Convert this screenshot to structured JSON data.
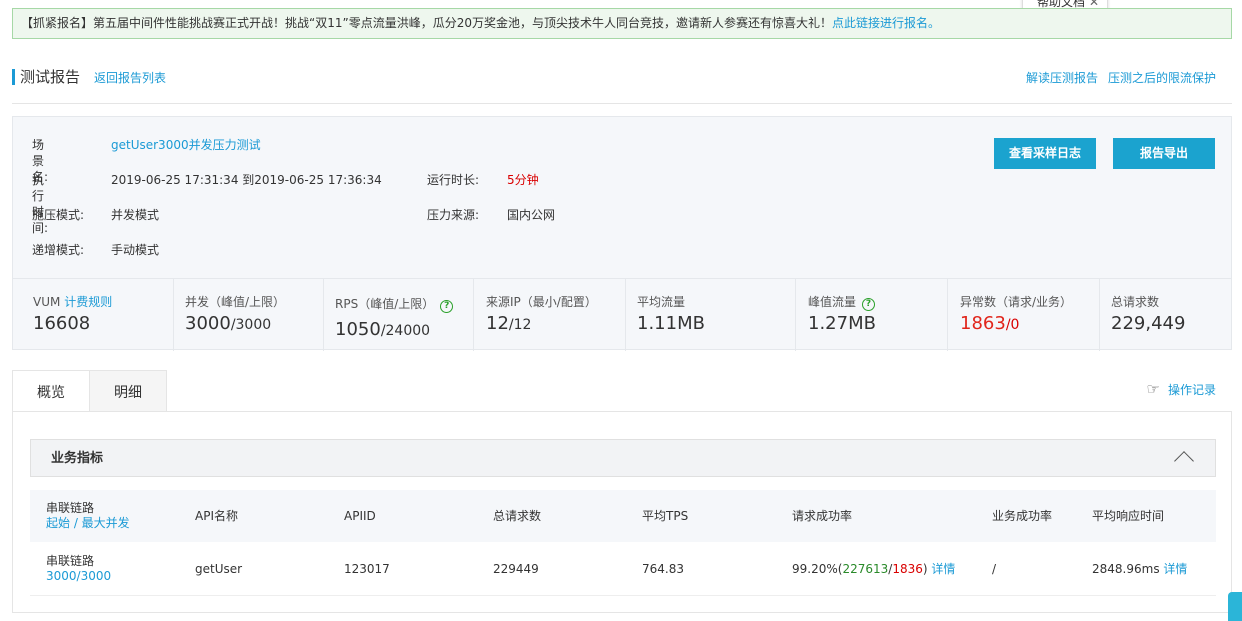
{
  "banner": {
    "text": "【抓紧报名】第五届中间件性能挑战赛正式开战！挑战“双11”零点流量洪峰，瓜分20万奖金池，与顶尖技术牛人同台竞技，邀请新人参赛还有惊喜大礼！",
    "link": "点此链接进行报名。"
  },
  "help": {
    "label": "帮助文档",
    "close": "✕"
  },
  "header": {
    "title": "测试报告",
    "back": "返回报告列表",
    "links": [
      "解读压测报告",
      "压测之后的限流保护"
    ]
  },
  "info": {
    "scene_label": "场景名:",
    "scene_value": "getUser3000并发压力测试",
    "time_label": "执行时间:",
    "time_value": "2019-06-25 17:31:34 到2019-06-25 17:36:34",
    "duration_label": "运行时长:",
    "duration_value": "5分钟",
    "mode_label": "施压模式:",
    "mode_value": "并发模式",
    "source_label": "压力来源:",
    "source_value": "国内公网",
    "ramp_label": "递增模式:",
    "ramp_value": "手动模式",
    "btn_log": "查看采样日志",
    "btn_export": "报告导出"
  },
  "metrics": {
    "vum_label": "VUM",
    "vum_link": "计费规则",
    "vum_value": "16608",
    "concurrency_label": "并发（峰值/上限）",
    "concurrency_peak": "3000",
    "concurrency_limit": "/3000",
    "rps_label": "RPS（峰值/上限）",
    "rps_peak": "1050",
    "rps_limit": "/24000",
    "ip_label": "来源IP（最小/配置）",
    "ip_min": "12",
    "ip_conf": "/12",
    "avg_flow_label": "平均流量",
    "avg_flow_value": "1.11MB",
    "peak_flow_label": "峰值流量",
    "peak_flow_value": "1.27MB",
    "error_label": "异常数（请求/业务）",
    "error_req": "1863",
    "error_biz": "/0",
    "total_label": "总请求数",
    "total_value": "229,449",
    "help_glyph": "?"
  },
  "tabs": [
    "概览",
    "明细"
  ],
  "op_record": {
    "icon": "☞",
    "label": "操作记录"
  },
  "section": {
    "title": "业务指标"
  },
  "table": {
    "headers": {
      "chain": "串联链路",
      "chain_sub": "起始 / 最大并发",
      "api_name": "API名称",
      "api_id": "APIID",
      "total": "总请求数",
      "tps": "平均TPS",
      "success": "请求成功率",
      "biz_success": "业务成功率",
      "rt": "平均响应时间"
    },
    "rows": [
      {
        "chain": "串联链路",
        "chain_sub": "3000/3000",
        "api_name": "getUser",
        "api_id": "123017",
        "total": "229449",
        "tps": "764.83",
        "success_rate": "99.20%",
        "success_ok": "227613",
        "success_fail": "1836",
        "detail": "详情",
        "biz_success": "/",
        "rt": "2848.96ms"
      }
    ]
  }
}
